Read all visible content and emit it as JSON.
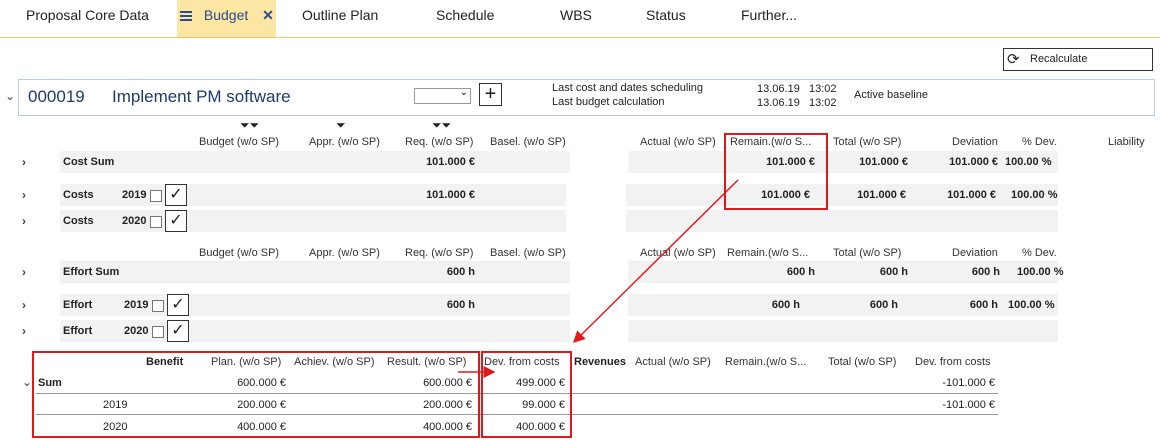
{
  "tabs": [
    {
      "label": "Proposal Core Data"
    },
    {
      "label": "Budget"
    },
    {
      "label": "Outline Plan"
    },
    {
      "label": "Schedule"
    },
    {
      "label": "WBS"
    },
    {
      "label": "Status"
    },
    {
      "label": "Further..."
    }
  ],
  "toolbar": {
    "recalculate_label": "Recalculate"
  },
  "header": {
    "project_id": "000019",
    "project_name": "Implement PM software",
    "last_cost_label": "Last cost and dates scheduling",
    "last_cost_date": "13.06.19",
    "last_cost_time": "13:02",
    "last_budget_label": "Last budget calculation",
    "last_budget_date": "13.06.19",
    "last_budget_time": "13:02",
    "baseline_status": "Active baseline"
  },
  "cost_columns": {
    "budget": "Budget (w/o SP)",
    "appr": "Appr. (w/o SP)",
    "req": "Req. (w/o SP)",
    "basel": "Basel. (w/o SP)",
    "actual": "Actual (w/o SP)",
    "remain": "Remain.(w/o S...",
    "total": "Total (w/o SP)",
    "deviation": "Deviation",
    "pdev": "% Dev.",
    "liability": "Liability"
  },
  "cost_rows": {
    "sum": {
      "label": "Cost Sum",
      "req": "101.000 €",
      "remain": "101.000 €",
      "total": "101.000 €",
      "deviation": "101.000 €",
      "pdev": "100.00 %"
    },
    "y2019": {
      "label": "Costs",
      "year": "2019",
      "req": "101.000 €",
      "remain": "101.000 €",
      "total": "101.000 €",
      "deviation": "101.000 €",
      "pdev": "100.00 %"
    },
    "y2020": {
      "label": "Costs",
      "year": "2020"
    }
  },
  "effort_columns": {
    "budget": "Budget (w/o SP)",
    "appr": "Appr. (w/o SP)",
    "req": "Req. (w/o SP)",
    "basel": "Basel. (w/o SP)",
    "actual": "Actual (w/o SP)",
    "remain": "Remain.(w/o S...",
    "total": "Total (w/o SP)",
    "deviation": "Deviation",
    "pdev": "% Dev."
  },
  "effort_rows": {
    "sum": {
      "label": "Effort Sum",
      "req": "600 h",
      "remain": "600 h",
      "total": "600 h",
      "deviation": "600 h",
      "pdev": "100.00 %"
    },
    "y2019": {
      "label": "Effort",
      "year": "2019",
      "req": "600 h",
      "remain": "600 h",
      "total": "600 h",
      "deviation": "600 h",
      "pdev": "100.00 %"
    },
    "y2020": {
      "label": "Effort",
      "year": "2020"
    }
  },
  "benefit": {
    "title": "Benefit",
    "cols": {
      "plan": "Plan. (w/o SP)",
      "achiev": "Achiev. (w/o SP)",
      "result": "Result. (w/o SP)",
      "dev": "Dev. from costs"
    },
    "rows": [
      {
        "label": "Sum",
        "plan": "600.000 €",
        "result": "600.000 €",
        "dev": "499.000 €"
      },
      {
        "label": "2019",
        "plan": "200.000 €",
        "result": "200.000 €",
        "dev": "99.000 €"
      },
      {
        "label": "2020",
        "plan": "400.000 €",
        "result": "400.000 €",
        "dev": "400.000 €"
      }
    ]
  },
  "revenues": {
    "title": "Revenues",
    "cols": {
      "actual": "Actual (w/o SP)",
      "remain": "Remain.(w/o S...",
      "total": "Total (w/o SP)",
      "dev": "Dev. from costs"
    },
    "rows": [
      {
        "dev": "-101.000 €"
      },
      {
        "dev": "-101.000 €"
      },
      {
        "dev": ""
      }
    ]
  },
  "colors": {
    "accent": "#fce6a4",
    "tab_border": "#f0c869",
    "highlight": "#e01a1a",
    "id_blue": "#1f3a6e"
  }
}
